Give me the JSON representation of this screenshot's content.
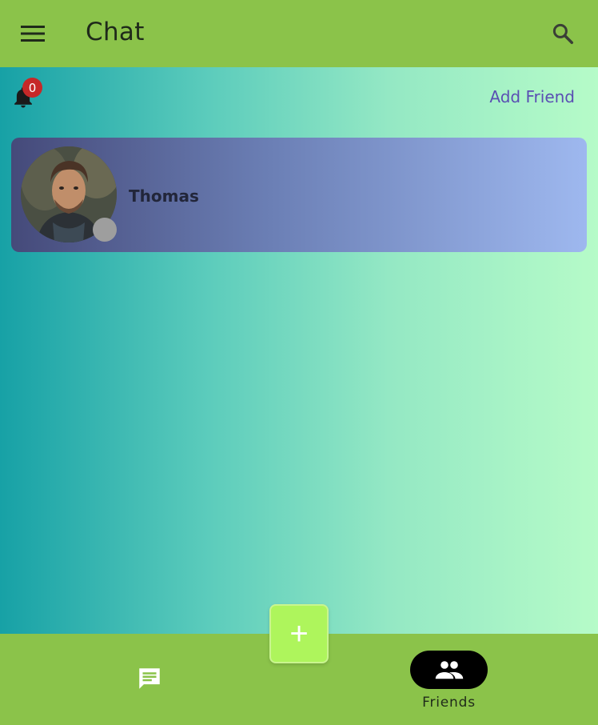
{
  "app_bar": {
    "title": "Chat",
    "menu_icon": "menu-icon",
    "search_icon": "search-icon"
  },
  "notifications": {
    "icon": "bell-icon",
    "count": "0"
  },
  "actions": {
    "add_friend_label": "Add Friend"
  },
  "friends": [
    {
      "name": "Thomas",
      "status": "offline",
      "status_color": "#9e9e9e"
    }
  ],
  "fab": {
    "label": "+"
  },
  "bottom_nav": {
    "items": [
      {
        "icon": "chat-icon",
        "label": "",
        "selected": false
      },
      {
        "icon": "people-icon",
        "label": "Friends",
        "selected": true
      }
    ]
  },
  "colors": {
    "app_bar": "#8bc34a",
    "accent": "#5a4fb3",
    "badge": "#c62828",
    "fab": "#aef55c"
  }
}
